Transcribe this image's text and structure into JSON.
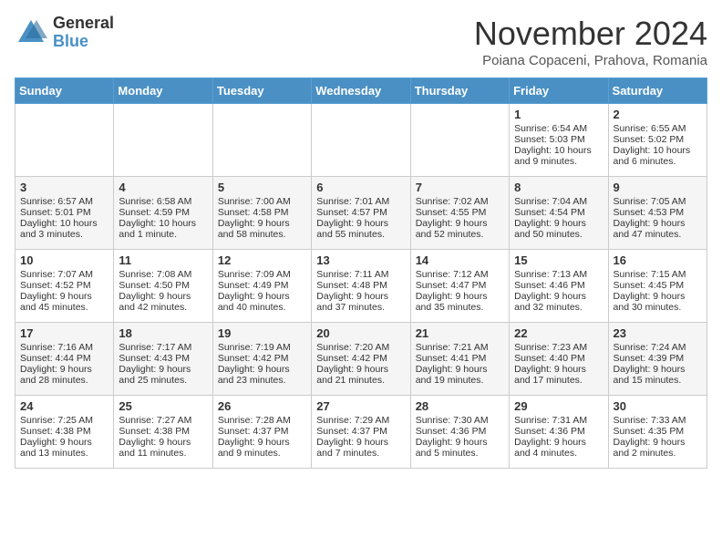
{
  "logo": {
    "general": "General",
    "blue": "Blue"
  },
  "title": "November 2024",
  "location": "Poiana Copaceni, Prahova, Romania",
  "days_of_week": [
    "Sunday",
    "Monday",
    "Tuesday",
    "Wednesday",
    "Thursday",
    "Friday",
    "Saturday"
  ],
  "weeks": [
    [
      {
        "day": "",
        "info": ""
      },
      {
        "day": "",
        "info": ""
      },
      {
        "day": "",
        "info": ""
      },
      {
        "day": "",
        "info": ""
      },
      {
        "day": "",
        "info": ""
      },
      {
        "day": "1",
        "info": "Sunrise: 6:54 AM\nSunset: 5:03 PM\nDaylight: 10 hours and 9 minutes."
      },
      {
        "day": "2",
        "info": "Sunrise: 6:55 AM\nSunset: 5:02 PM\nDaylight: 10 hours and 6 minutes."
      }
    ],
    [
      {
        "day": "3",
        "info": "Sunrise: 6:57 AM\nSunset: 5:01 PM\nDaylight: 10 hours and 3 minutes."
      },
      {
        "day": "4",
        "info": "Sunrise: 6:58 AM\nSunset: 4:59 PM\nDaylight: 10 hours and 1 minute."
      },
      {
        "day": "5",
        "info": "Sunrise: 7:00 AM\nSunset: 4:58 PM\nDaylight: 9 hours and 58 minutes."
      },
      {
        "day": "6",
        "info": "Sunrise: 7:01 AM\nSunset: 4:57 PM\nDaylight: 9 hours and 55 minutes."
      },
      {
        "day": "7",
        "info": "Sunrise: 7:02 AM\nSunset: 4:55 PM\nDaylight: 9 hours and 52 minutes."
      },
      {
        "day": "8",
        "info": "Sunrise: 7:04 AM\nSunset: 4:54 PM\nDaylight: 9 hours and 50 minutes."
      },
      {
        "day": "9",
        "info": "Sunrise: 7:05 AM\nSunset: 4:53 PM\nDaylight: 9 hours and 47 minutes."
      }
    ],
    [
      {
        "day": "10",
        "info": "Sunrise: 7:07 AM\nSunset: 4:52 PM\nDaylight: 9 hours and 45 minutes."
      },
      {
        "day": "11",
        "info": "Sunrise: 7:08 AM\nSunset: 4:50 PM\nDaylight: 9 hours and 42 minutes."
      },
      {
        "day": "12",
        "info": "Sunrise: 7:09 AM\nSunset: 4:49 PM\nDaylight: 9 hours and 40 minutes."
      },
      {
        "day": "13",
        "info": "Sunrise: 7:11 AM\nSunset: 4:48 PM\nDaylight: 9 hours and 37 minutes."
      },
      {
        "day": "14",
        "info": "Sunrise: 7:12 AM\nSunset: 4:47 PM\nDaylight: 9 hours and 35 minutes."
      },
      {
        "day": "15",
        "info": "Sunrise: 7:13 AM\nSunset: 4:46 PM\nDaylight: 9 hours and 32 minutes."
      },
      {
        "day": "16",
        "info": "Sunrise: 7:15 AM\nSunset: 4:45 PM\nDaylight: 9 hours and 30 minutes."
      }
    ],
    [
      {
        "day": "17",
        "info": "Sunrise: 7:16 AM\nSunset: 4:44 PM\nDaylight: 9 hours and 28 minutes."
      },
      {
        "day": "18",
        "info": "Sunrise: 7:17 AM\nSunset: 4:43 PM\nDaylight: 9 hours and 25 minutes."
      },
      {
        "day": "19",
        "info": "Sunrise: 7:19 AM\nSunset: 4:42 PM\nDaylight: 9 hours and 23 minutes."
      },
      {
        "day": "20",
        "info": "Sunrise: 7:20 AM\nSunset: 4:42 PM\nDaylight: 9 hours and 21 minutes."
      },
      {
        "day": "21",
        "info": "Sunrise: 7:21 AM\nSunset: 4:41 PM\nDaylight: 9 hours and 19 minutes."
      },
      {
        "day": "22",
        "info": "Sunrise: 7:23 AM\nSunset: 4:40 PM\nDaylight: 9 hours and 17 minutes."
      },
      {
        "day": "23",
        "info": "Sunrise: 7:24 AM\nSunset: 4:39 PM\nDaylight: 9 hours and 15 minutes."
      }
    ],
    [
      {
        "day": "24",
        "info": "Sunrise: 7:25 AM\nSunset: 4:38 PM\nDaylight: 9 hours and 13 minutes."
      },
      {
        "day": "25",
        "info": "Sunrise: 7:27 AM\nSunset: 4:38 PM\nDaylight: 9 hours and 11 minutes."
      },
      {
        "day": "26",
        "info": "Sunrise: 7:28 AM\nSunset: 4:37 PM\nDaylight: 9 hours and 9 minutes."
      },
      {
        "day": "27",
        "info": "Sunrise: 7:29 AM\nSunset: 4:37 PM\nDaylight: 9 hours and 7 minutes."
      },
      {
        "day": "28",
        "info": "Sunrise: 7:30 AM\nSunset: 4:36 PM\nDaylight: 9 hours and 5 minutes."
      },
      {
        "day": "29",
        "info": "Sunrise: 7:31 AM\nSunset: 4:36 PM\nDaylight: 9 hours and 4 minutes."
      },
      {
        "day": "30",
        "info": "Sunrise: 7:33 AM\nSunset: 4:35 PM\nDaylight: 9 hours and 2 minutes."
      }
    ]
  ]
}
